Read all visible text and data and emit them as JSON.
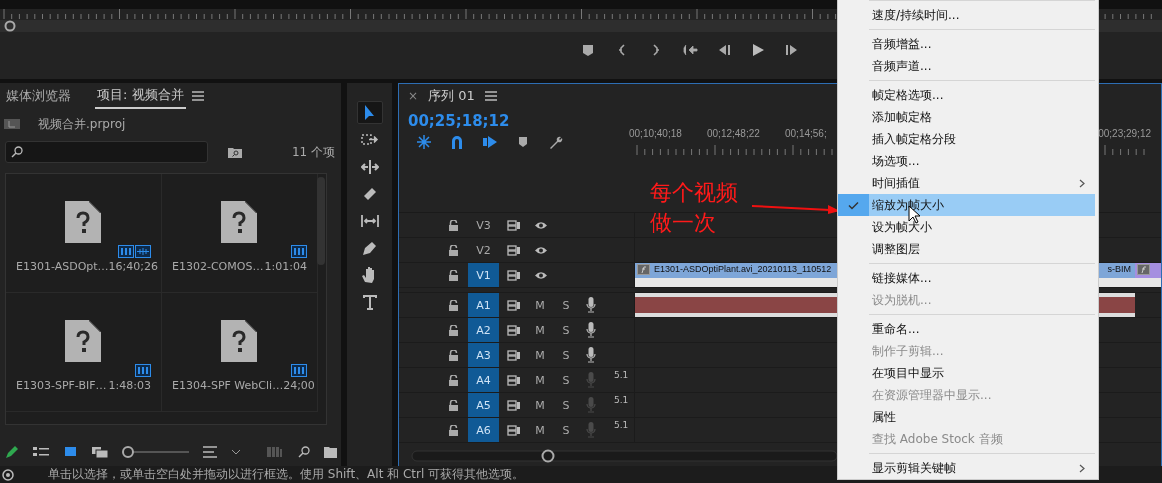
{
  "monitor": {
    "transport": [
      {
        "kind": "marker"
      },
      {
        "kind": "mark-in"
      },
      {
        "kind": "mark-out"
      },
      {
        "kind": "go-to-in"
      },
      {
        "kind": "step-back"
      },
      {
        "kind": "play"
      },
      {
        "kind": "step-forward"
      }
    ]
  },
  "project_panel": {
    "tabs": [
      {
        "label": "媒体浏览器",
        "selected": false
      },
      {
        "label": "项目: 视频合并",
        "selected": true
      }
    ],
    "file": "视频合并.prproj",
    "count": "11 个项",
    "items": [
      {
        "name": "E1301-ASDOpt…",
        "duration": "16;40;26",
        "has_audio": true
      },
      {
        "name": "E1302-COMOS…",
        "duration": "1:01:04",
        "has_audio": false
      },
      {
        "name": "E1303-SPF-BIF…",
        "duration": "1:48:03",
        "has_audio": false
      },
      {
        "name": "E1304-SPF WebCli…",
        "duration": "24;00",
        "has_audio": false
      }
    ],
    "views": [
      {
        "kind": "list",
        "selected": false
      },
      {
        "kind": "icon",
        "selected": true
      },
      {
        "kind": "freeform",
        "selected": false
      }
    ],
    "zoom": {
      "level": 0.0
    }
  },
  "tools": [
    {
      "kind": "selection",
      "selected": true
    },
    {
      "kind": "track-select",
      "selected": false
    },
    {
      "kind": "ripple",
      "selected": false
    },
    {
      "kind": "razor",
      "selected": false
    },
    {
      "kind": "slip",
      "selected": false
    },
    {
      "kind": "pen",
      "selected": false
    },
    {
      "kind": "hand",
      "selected": false
    },
    {
      "kind": "type",
      "selected": false
    }
  ],
  "timeline": {
    "close": "×",
    "title": "序列 01",
    "timecode": "00;25;18;12",
    "controls": [
      {
        "kind": "nest",
        "on": true
      },
      {
        "kind": "snap",
        "on": true
      },
      {
        "kind": "linked",
        "on": true
      },
      {
        "kind": "marker",
        "on": false
      },
      {
        "kind": "settings",
        "on": false
      }
    ],
    "ruler": [
      "00;10;40;18",
      "00;12;48;22",
      "00;14;56;",
      "00;23;29;12"
    ],
    "tracks": [
      {
        "label": "V3",
        "kind": "video",
        "targeted": false
      },
      {
        "label": "V2",
        "kind": "video",
        "targeted": false
      },
      {
        "label": "V1",
        "kind": "video",
        "targeted": true,
        "clips": [
          {
            "name": "E1301-ASDOptiPlant.avi_20210113_110512",
            "color": "#7ea6d8"
          },
          {
            "name": "s-BIM",
            "color": "#7ea6d8"
          },
          {
            "color": "#a58fe0"
          }
        ]
      },
      {
        "label": "A1",
        "kind": "audio",
        "targeted": true,
        "mute": "M",
        "solo": "S",
        "mic_on": true,
        "clips": [
          {
            "color": "#8a4545"
          }
        ]
      },
      {
        "label": "A2",
        "kind": "audio",
        "targeted": true,
        "mute": "M",
        "solo": "S",
        "mic_on": true
      },
      {
        "label": "A3",
        "kind": "audio",
        "targeted": true,
        "mute": "M",
        "solo": "S",
        "mic_on": true
      },
      {
        "label": "A4",
        "kind": "audio",
        "targeted": true,
        "mute": "M",
        "solo": "S",
        "mic_on": false,
        "channels": "5.1"
      },
      {
        "label": "A5",
        "kind": "audio",
        "targeted": true,
        "mute": "M",
        "solo": "S",
        "mic_on": false,
        "channels": "5.1"
      },
      {
        "label": "A6",
        "kind": "audio",
        "targeted": true,
        "mute": "M",
        "solo": "S",
        "mic_on": false,
        "channels": "5.1"
      }
    ]
  },
  "annotation": {
    "lines": [
      "每个视频",
      "做一次"
    ]
  },
  "context_menu": {
    "groups": [
      {
        "items": [
          {
            "label": "速度/持续时间...",
            "selected": false
          }
        ]
      },
      {
        "items": [
          {
            "label": "音频增益...",
            "selected": false
          },
          {
            "label": "音频声道...",
            "selected": false
          }
        ]
      },
      {
        "items": [
          {
            "label": "帧定格选项...",
            "selected": false
          },
          {
            "label": "添加帧定格",
            "selected": false
          },
          {
            "label": "插入帧定格分段",
            "selected": false
          },
          {
            "label": "场选项...",
            "selected": false
          },
          {
            "label": "时间插值",
            "submenu": true,
            "selected": false
          },
          {
            "label": "缩放为帧大小",
            "checked": true,
            "selected": true
          },
          {
            "label": "设为帧大小",
            "selected": false
          },
          {
            "label": "调整图层",
            "selected": false
          }
        ]
      },
      {
        "items": [
          {
            "label": "链接媒体...",
            "selected": false
          },
          {
            "label": "设为脱机...",
            "disabled": true,
            "selected": false
          }
        ]
      },
      {
        "items": [
          {
            "label": "重命名...",
            "selected": false
          },
          {
            "label": "制作子剪辑...",
            "disabled": true,
            "selected": false
          },
          {
            "label": "在项目中显示",
            "selected": false
          },
          {
            "label": "在资源管理器中显示...",
            "disabled": true,
            "selected": false
          },
          {
            "label": "属性",
            "selected": false
          },
          {
            "label": "查找 Adobe Stock 音频",
            "disabled": true,
            "selected": false
          }
        ]
      },
      {
        "items": [
          {
            "label": "显示剪辑关键帧",
            "submenu": true,
            "selected": false
          }
        ]
      }
    ]
  },
  "status_bar": {
    "text": "单击以选择，或单击空白处并拖动以进行框选。使用 Shift、Alt 和 Ctrl 可获得其他选项。"
  }
}
